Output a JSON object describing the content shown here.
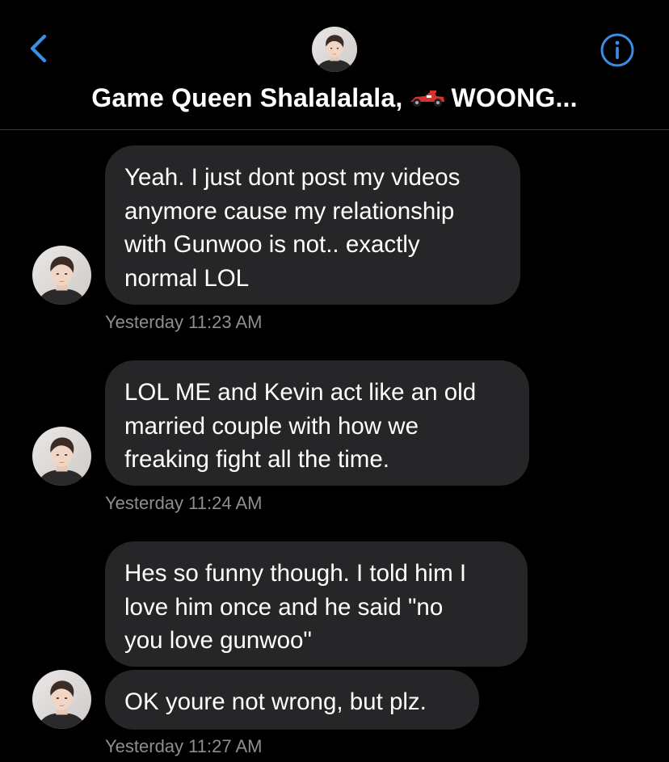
{
  "header": {
    "title_part1": "Game Queen Shalalalala,",
    "title_part2": "WOONG...",
    "title_emoji": "racing-car-icon"
  },
  "colors": {
    "background": "#000000",
    "bubble": "#262629",
    "accent": "#3a8ee6",
    "timestamp": "#8e8e93",
    "divider": "#3a3a3c"
  },
  "messages": [
    {
      "lines": [
        "Yeah. I just dont post my videos",
        "anymore cause my relationship",
        "with Gunwoo is not.. exactly",
        "normal LOL"
      ],
      "timestamp": "Yesterday 11:23 AM"
    },
    {
      "lines": [
        "LOL ME and Kevin act like an old",
        "married couple with how we",
        "freaking fight all the time."
      ],
      "timestamp": "Yesterday 11:24 AM"
    },
    {
      "lines": [
        "Hes so funny though. I told him I",
        "love him once and he said \"no",
        "you love gunwoo\""
      ]
    },
    {
      "lines": [
        "OK youre not wrong, but plz."
      ],
      "timestamp": "Yesterday 11:27 AM"
    }
  ]
}
